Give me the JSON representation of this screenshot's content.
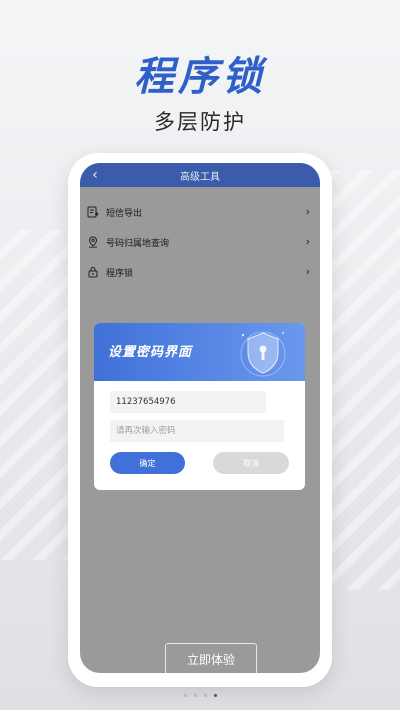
{
  "promo": {
    "title": "程序锁",
    "subtitle": "多层防护",
    "cta_label": "立即体验",
    "page_count": 4,
    "active_page": 4
  },
  "app": {
    "header_title": "高级工具",
    "menu": [
      {
        "label": "短信导出",
        "icon": "sms-export-icon"
      },
      {
        "label": "号码归属地查询",
        "icon": "location-pin-icon"
      },
      {
        "label": "程序锁",
        "icon": "lock-icon"
      }
    ]
  },
  "dialog": {
    "title": "设置密码界面",
    "password_value": "11237654976",
    "confirm_placeholder": "请再次输入密码",
    "ok_label": "确定",
    "cancel_label": "取消",
    "icon": "shield-icon"
  },
  "colors": {
    "accent": "#2f5fc8",
    "app_header": "#3a5caa",
    "dialog_gradient_start": "#3f71d8",
    "dialog_gradient_end": "#6b98ee",
    "overlay": "#9a9a9a"
  }
}
